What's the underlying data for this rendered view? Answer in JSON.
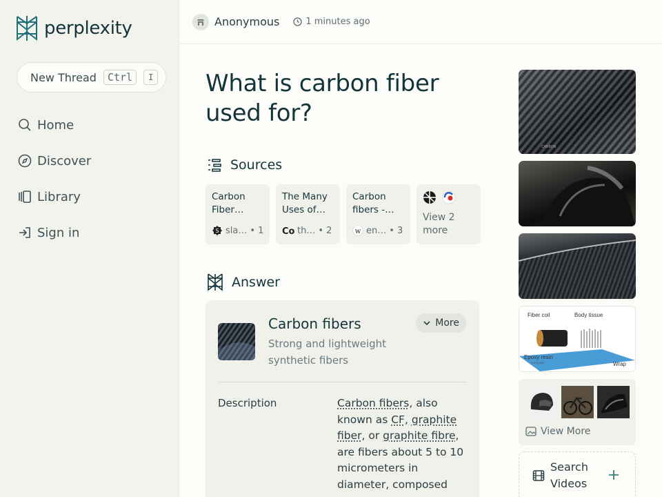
{
  "brand": {
    "name": "perplexity",
    "accent": "#1f6f78"
  },
  "sidebar": {
    "new_thread_label": "New Thread",
    "shortcut_key1": "Ctrl",
    "shortcut_key2": "I",
    "items": [
      {
        "label": "Home",
        "icon": "search-icon"
      },
      {
        "label": "Discover",
        "icon": "compass-icon"
      },
      {
        "label": "Library",
        "icon": "library-icon"
      },
      {
        "label": "Sign in",
        "icon": "sign-in-icon"
      }
    ]
  },
  "header": {
    "user": "Anonymous",
    "time": "1 minutes ago"
  },
  "question": "What is carbon fiber used for?",
  "sources_section": {
    "heading": "Sources",
    "cards": [
      {
        "title": "Carbon Fiber…",
        "site": "sla…",
        "index": "• 1"
      },
      {
        "title": "The Many Uses of…",
        "site": "th…",
        "index": "• 2"
      },
      {
        "title": "Carbon fibers -…",
        "site": "en…",
        "index": "• 3"
      }
    ],
    "view_more": "View 2 more"
  },
  "answer_section": {
    "heading": "Answer",
    "card": {
      "title": "Carbon fibers",
      "subtitle": "Strong and lightweight synthetic fibers",
      "more_label": "More",
      "description_label": "Description",
      "description": {
        "link1": "Carbon fibers",
        "t1": ", also known as ",
        "link2": "CF",
        "t2": ", ",
        "link3": "graphite fiber",
        "t3": ", or ",
        "link4": "graphite fibre",
        "t4": ", are fibers about 5 to 10 micrometers in diameter, composed"
      }
    }
  },
  "images": {
    "img1_caption": "CARBON",
    "diagram_labels": {
      "fiber_coil": "Fiber coil",
      "body_tissue": "Body tissue",
      "epoxy": "Epoxy resin",
      "epoxy_sub": "mix liquid",
      "wrap": "Wrap"
    },
    "view_more": "View More"
  },
  "search_videos": {
    "label": "Search Videos"
  }
}
